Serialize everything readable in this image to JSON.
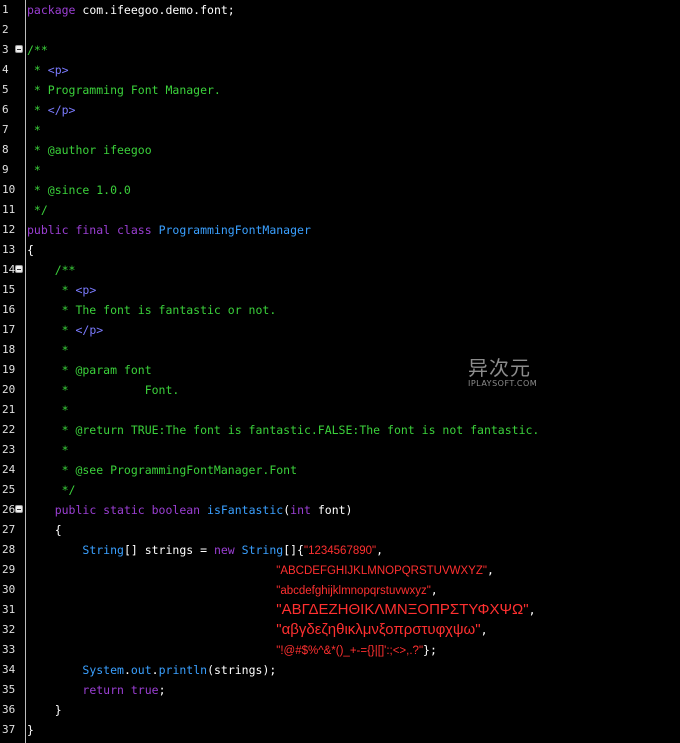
{
  "editor": {
    "lines": [
      {
        "n": "1",
        "s": [
          [
            "kw",
            "package"
          ],
          [
            "id",
            " com.ifeegoo.demo.font;"
          ]
        ]
      },
      {
        "n": "2",
        "s": []
      },
      {
        "n": "3",
        "fold": true,
        "s": [
          [
            "cm",
            "/**"
          ]
        ]
      },
      {
        "n": "4",
        "s": [
          [
            "cm",
            " * "
          ],
          [
            "tag",
            "<p>"
          ]
        ]
      },
      {
        "n": "5",
        "s": [
          [
            "cm",
            " * Programming Font Manager."
          ]
        ]
      },
      {
        "n": "6",
        "s": [
          [
            "cm",
            " * "
          ],
          [
            "tag",
            "</p>"
          ]
        ]
      },
      {
        "n": "7",
        "s": [
          [
            "cm",
            " *"
          ]
        ]
      },
      {
        "n": "8",
        "s": [
          [
            "cm",
            " * @author ifeegoo"
          ]
        ]
      },
      {
        "n": "9",
        "s": [
          [
            "cm",
            " *"
          ]
        ]
      },
      {
        "n": "10",
        "s": [
          [
            "cm",
            " * @since 1.0.0"
          ]
        ]
      },
      {
        "n": "11",
        "s": [
          [
            "cm",
            " */"
          ]
        ]
      },
      {
        "n": "12",
        "s": [
          [
            "kw",
            "public final class "
          ],
          [
            "cls",
            "ProgrammingFontManager"
          ]
        ]
      },
      {
        "n": "13",
        "s": [
          [
            "id",
            "{"
          ]
        ]
      },
      {
        "n": "14",
        "fold": true,
        "s": [
          [
            "cm",
            "    /**"
          ]
        ]
      },
      {
        "n": "15",
        "s": [
          [
            "cm",
            "     * "
          ],
          [
            "tag",
            "<p>"
          ]
        ]
      },
      {
        "n": "16",
        "s": [
          [
            "cm",
            "     * The font is fantastic or not."
          ]
        ]
      },
      {
        "n": "17",
        "s": [
          [
            "cm",
            "     * "
          ],
          [
            "tag",
            "</p>"
          ]
        ]
      },
      {
        "n": "18",
        "s": [
          [
            "cm",
            "     *"
          ]
        ]
      },
      {
        "n": "19",
        "s": [
          [
            "cm",
            "     * @param font"
          ]
        ]
      },
      {
        "n": "20",
        "s": [
          [
            "cm",
            "     *           Font."
          ]
        ]
      },
      {
        "n": "21",
        "s": [
          [
            "cm",
            "     *"
          ]
        ]
      },
      {
        "n": "22",
        "s": [
          [
            "cm",
            "     * @return TRUE:The font is fantastic.FALSE:The font is not fantastic."
          ]
        ]
      },
      {
        "n": "23",
        "s": [
          [
            "cm",
            "     *"
          ]
        ]
      },
      {
        "n": "24",
        "s": [
          [
            "cm",
            "     * @see ProgrammingFontManager.Font"
          ]
        ]
      },
      {
        "n": "25",
        "s": [
          [
            "cm",
            "     */"
          ]
        ]
      },
      {
        "n": "26",
        "fold": true,
        "s": [
          [
            "id",
            "    "
          ],
          [
            "kw",
            "public static boolean "
          ],
          [
            "cls",
            "isFantastic"
          ],
          [
            "id",
            "("
          ],
          [
            "kw",
            "int"
          ],
          [
            "id",
            " font)"
          ]
        ]
      },
      {
        "n": "27",
        "s": [
          [
            "id",
            "    {"
          ]
        ]
      },
      {
        "n": "28",
        "s": [
          [
            "id",
            "        "
          ],
          [
            "cls",
            "String"
          ],
          [
            "id",
            "[] strings = "
          ],
          [
            "kw",
            "new "
          ],
          [
            "cls",
            "String"
          ],
          [
            "id",
            "[]{"
          ],
          [
            "str",
            "\"1234567890\""
          ],
          [
            "id",
            ","
          ]
        ]
      },
      {
        "n": "29",
        "s": [
          [
            "id",
            "                                    "
          ],
          [
            "str",
            "\"ABCDEFGHIJKLMNOPQRSTUVWXYZ\""
          ],
          [
            "id",
            ","
          ]
        ]
      },
      {
        "n": "30",
        "s": [
          [
            "id",
            "                                    "
          ],
          [
            "str",
            "\"abcdefghijklmnopqrstuvwxyz\""
          ],
          [
            "id",
            ","
          ]
        ]
      },
      {
        "n": "31",
        "s": [
          [
            "id",
            "                                    "
          ],
          [
            "str big",
            "\"ΑΒΓΔΕΖΗΘΙΚΛΜΝΞΟΠΡΣΤΥΦΧΨΩ\""
          ],
          [
            "id",
            ","
          ]
        ]
      },
      {
        "n": "32",
        "s": [
          [
            "id",
            "                                    "
          ],
          [
            "str big",
            "\"αβγδεζηθικλμνξοπρστυφχψω\""
          ],
          [
            "id",
            ","
          ]
        ]
      },
      {
        "n": "33",
        "s": [
          [
            "id",
            "                                    "
          ],
          [
            "str",
            "\"!@#$%^&*()_+-={}|[]':;<>,.?\""
          ],
          [
            "id",
            "};"
          ]
        ]
      },
      {
        "n": "34",
        "s": [
          [
            "id",
            "        "
          ],
          [
            "cls",
            "System"
          ],
          [
            "id",
            "."
          ],
          [
            "fld",
            "out"
          ],
          [
            "id",
            "."
          ],
          [
            "cls",
            "println"
          ],
          [
            "id",
            "(strings);"
          ]
        ]
      },
      {
        "n": "35",
        "s": [
          [
            "id",
            "        "
          ],
          [
            "kw",
            "return true"
          ],
          [
            "id",
            ";"
          ]
        ]
      },
      {
        "n": "36",
        "s": [
          [
            "id",
            "    }"
          ]
        ]
      },
      {
        "n": "37",
        "s": [
          [
            "id",
            "}"
          ]
        ]
      }
    ]
  },
  "watermark": {
    "main": "异次元",
    "sub": "IPLAYSOFT.COM"
  }
}
